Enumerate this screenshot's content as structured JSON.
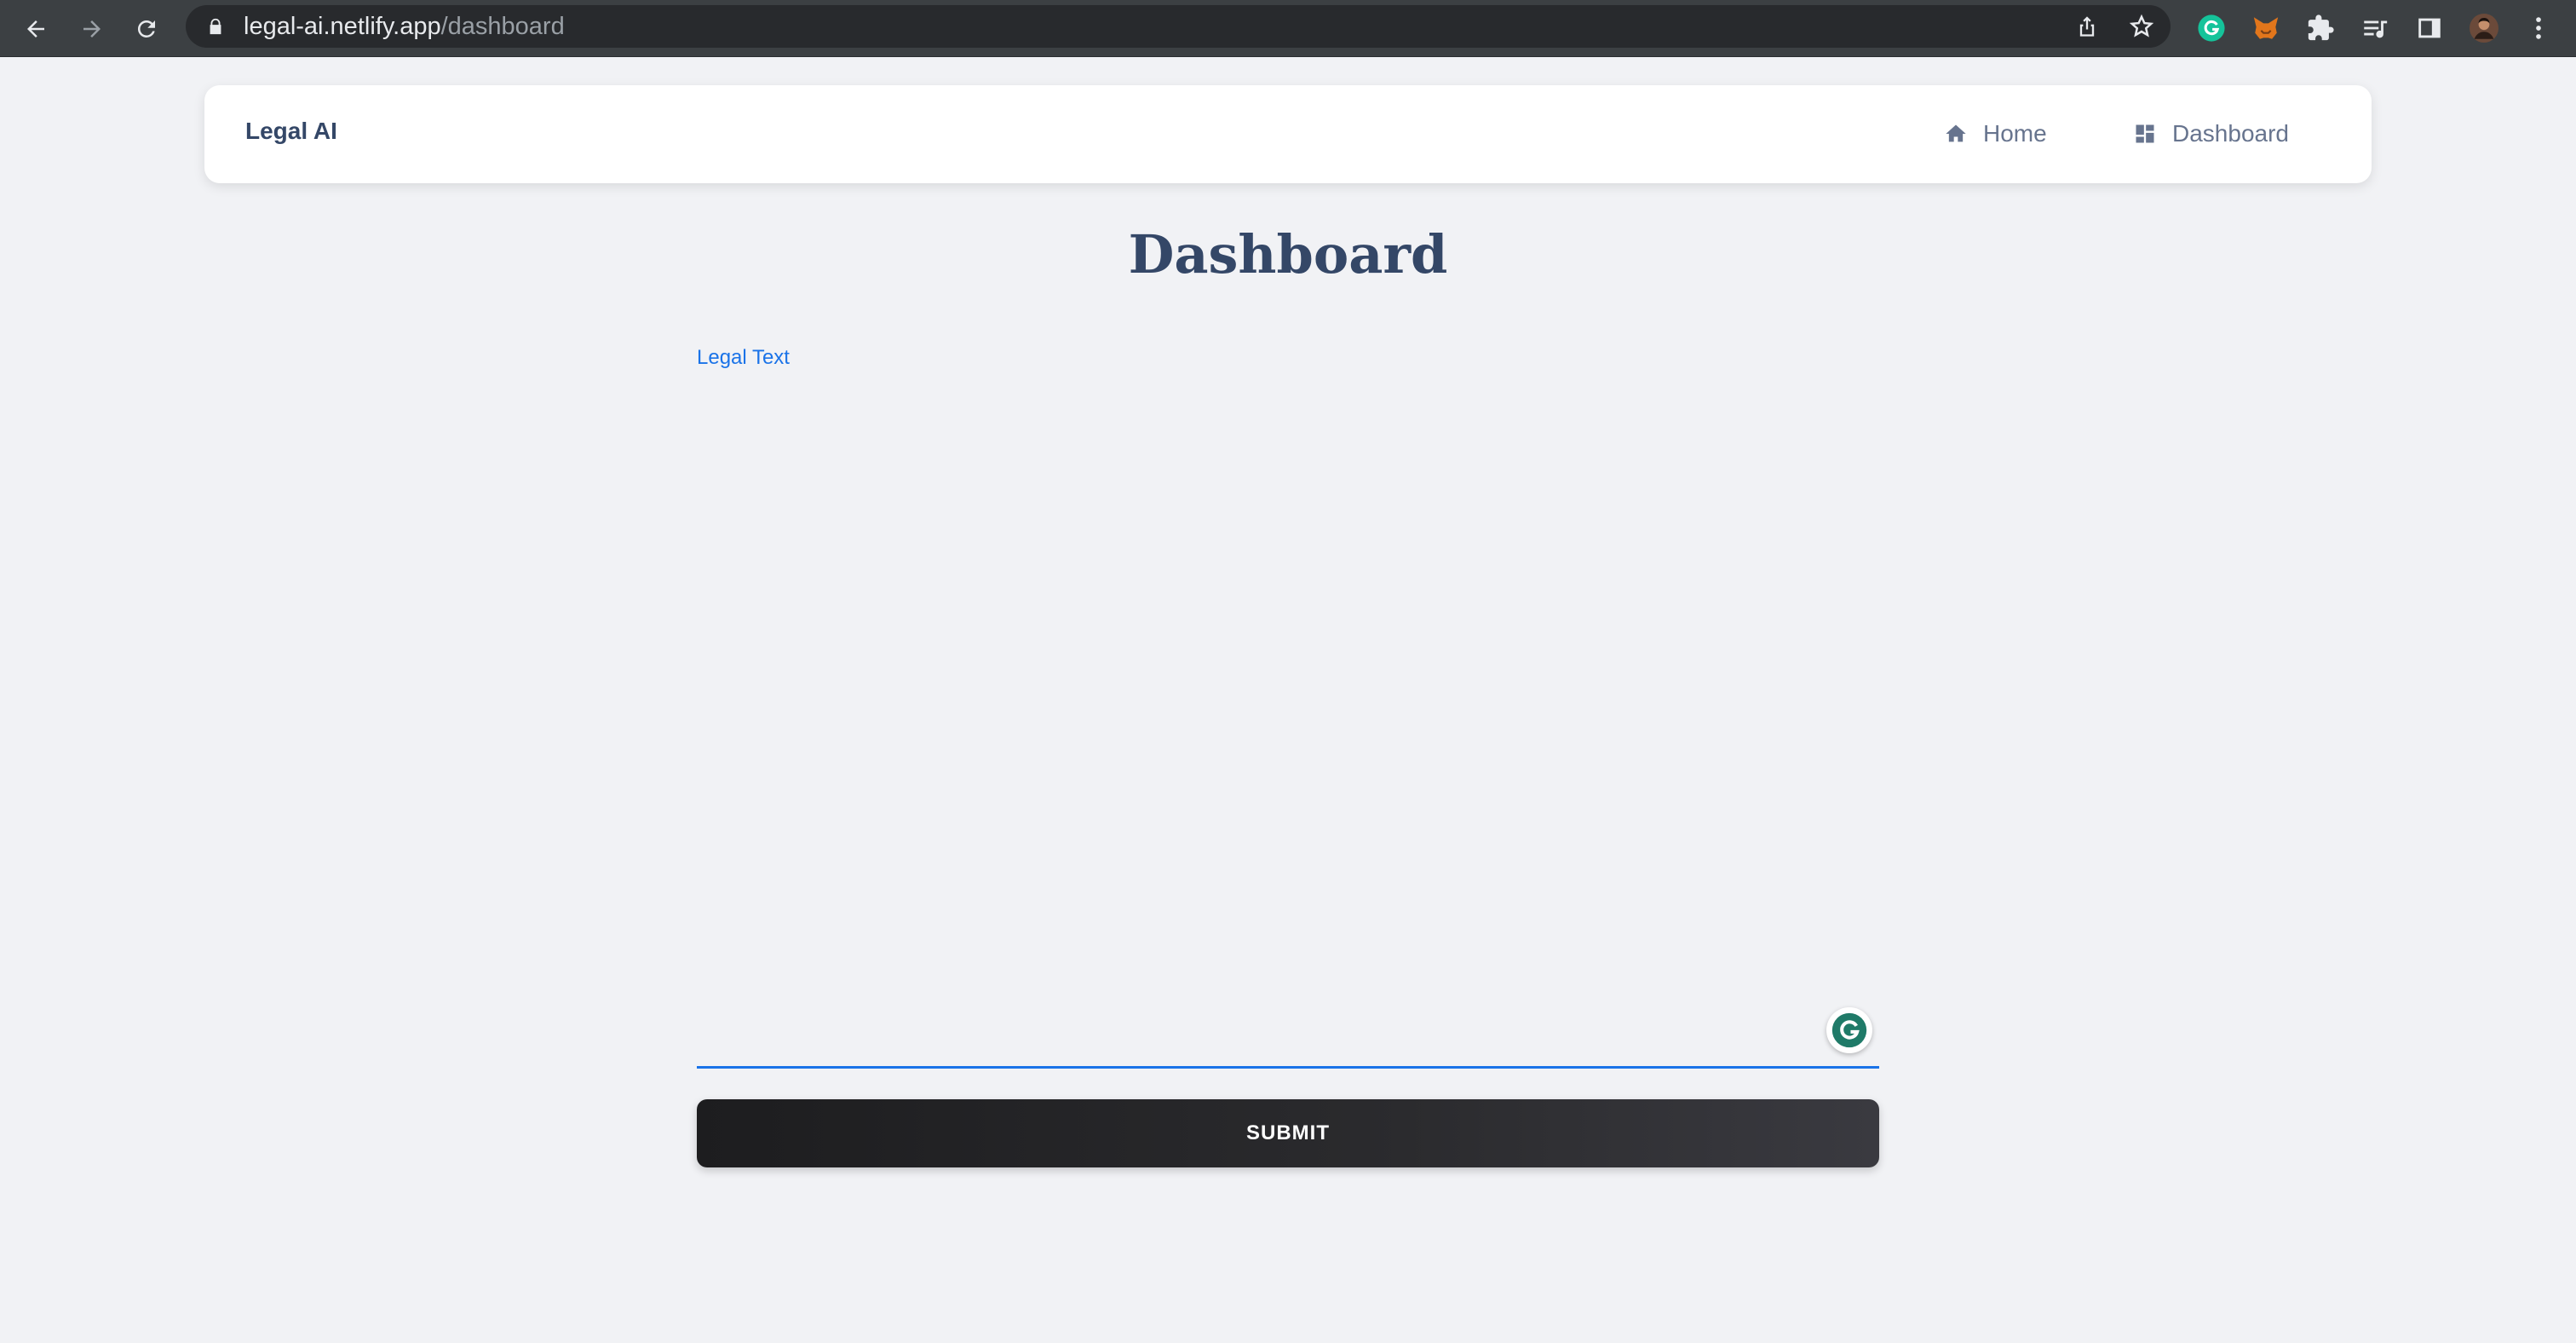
{
  "browser": {
    "url_host": "legal-ai.netlify.app",
    "url_path": "/dashboard"
  },
  "navbar": {
    "brand": "Legal AI",
    "links": [
      {
        "label": "Home",
        "icon": "home-icon"
      },
      {
        "label": "Dashboard",
        "icon": "dashboard-icon"
      }
    ]
  },
  "main": {
    "title": "Dashboard",
    "legal_text_label": "Legal Text",
    "legal_text_value": "",
    "submit_label": "SUBMIT"
  },
  "colors": {
    "accent": "#1a73e8",
    "heading": "#344767",
    "page_bg": "#f1f2f5"
  }
}
